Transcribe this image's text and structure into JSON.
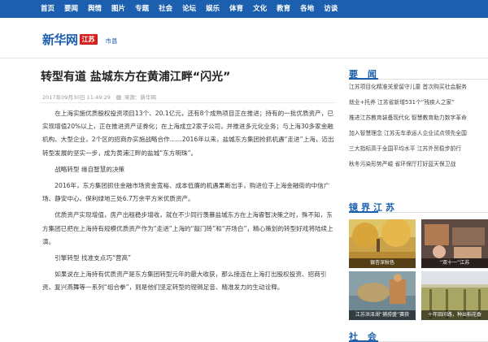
{
  "nav": {
    "items": [
      "首页",
      "要闻",
      "舆情",
      "图片",
      "专题",
      "社会",
      "论坛",
      "娱乐",
      "体育",
      "文化",
      "教育",
      "各地",
      "访谈"
    ]
  },
  "header": {
    "logo_text": "新华网",
    "region": "江苏",
    "breadcrumb": "市县"
  },
  "article": {
    "title": "转型有道 盐城东方在黄浦江畔“闪光”",
    "datetime": "2017年09月30日 11:49:29",
    "source": "来源：新华网",
    "paragraphs": [
      {
        "type": "para",
        "text": "在上海实施优质股权投资项目13个、20.1亿元，还有8个成熟项目正在推进；持有的一批优质资产，已实现增值20%以上，正在推进资产证券化；在上海成立2家子公司，并推进多元化业务；与上海30多家金融机构、大型企业，2个区的招商办实施战略合作……2016年以来，盐城东方集团抢抓机遇“走进”上海，迈出转型发展的坚实一步，成为黄浦江畔的盐城“东方明珠”。"
      },
      {
        "type": "sub",
        "text": "战略转型 缘自智慧的决策"
      },
      {
        "type": "para",
        "text": "2016年，东方集团抓住金融市场资金宽裕、成本低廉的机遇果断出手，购进位于上海金融街的中信广场、静安中心、保利绿地三处6.7万余平方米优质资产。"
      },
      {
        "type": "para",
        "text": "优质资产实现增值，房产出租稳步增收，就在不少同行羡慕盐城东方在上海睿智决策之时，殊不知，东方集团已把在上海持有规模优质资产作为“走进”上海的“敲门砖”和“开场白”，精心策划的转型好戏将陆续上演。"
      },
      {
        "type": "sub",
        "text": "引擎转型 找准支点巧“营高”"
      },
      {
        "type": "para",
        "text": "如果说在上海持有优质资产是东方集团转型元年的最大收获，那么接连在上海打出股权投资、招商引资、复兴燕舞等一系列“组合拳”，则是他们坚定转型的铿锵足音、精准发力的生动诠释。"
      }
    ]
  },
  "sidebar": {
    "news_title": "要 闻",
    "news": [
      "江苏项目化精准关爱留守儿童 首次购买社会服务",
      "就业+托养 江苏省新增531个“残疾人之家”",
      "推进江苏教育装备现代化 智慧教育助力数字革命",
      "加入智慧理念 江苏无车承运人企业试点领先全国",
      "三大指标高于全国平均水平 江苏外贸稳步前行",
      "秋冬污染形势严峻 省环保厅打好蓝天保卫战"
    ],
    "gallery_title": "镜界江苏",
    "gallery": [
      {
        "caption": "银杏深秋色"
      },
      {
        "caption": "“双十一”江苏"
      },
      {
        "caption": "江苏洪泽湖“捕捞盛”赛获"
      },
      {
        "caption": "十年田间路，种出稻花香"
      }
    ],
    "social_title": "社 会"
  },
  "colors": {
    "brand_blue": "#1b5fae",
    "logo_red": "#d4201e"
  }
}
